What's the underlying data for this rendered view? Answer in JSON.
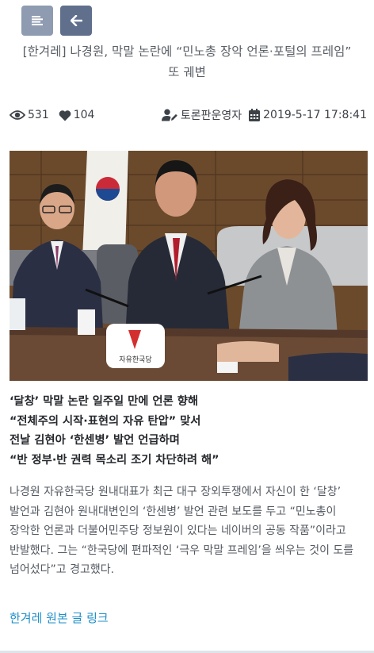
{
  "toolbar": {
    "menu_icon": "align-left-icon",
    "back_icon": "arrow-left-icon"
  },
  "article": {
    "title_line1": "[한겨레] 나경원, 막말 논란에 “민노총 장악 언론·포털의 프레임”",
    "title_line2": "또 궤변",
    "views": "531",
    "likes": "104",
    "author": "토론판운영자",
    "date": "2019-5-17 17:8:41",
    "subheads": [
      "‘달창’ 막말 논란 일주일 만에 언론 향해",
      "“전체주의 시작·표현의 자유 탄압” 맞서",
      "전날 김현아 ‘한센병’ 발언 언급하며",
      "“반 정부·반 권력 목소리 조기 차단하려 해”"
    ],
    "body": "나경원 자유한국당 원내대표가 최근 대구 장외투쟁에서 자신이 한 ‘달창’ 발언과 김현아 원내대변인의 ‘한센병’ 발언 관련 보도를 두고 “민노총이 장악한 언론과 더불어민주당 정보원이 있다는 네이버의 공동 작품”이라고 반발했다. 그는 “한국당에 편파적인 ‘극우 막말 프레임’을 씌우는 것이 도를 넘어섰다”고 경고했다.",
    "source_link": "한겨레 원본 글 링크",
    "photo_sign": "자유한국당"
  },
  "colors": {
    "menu_button": "#8e9bb1",
    "back_button": "#5f6f8c",
    "link": "#1f8fc9"
  }
}
